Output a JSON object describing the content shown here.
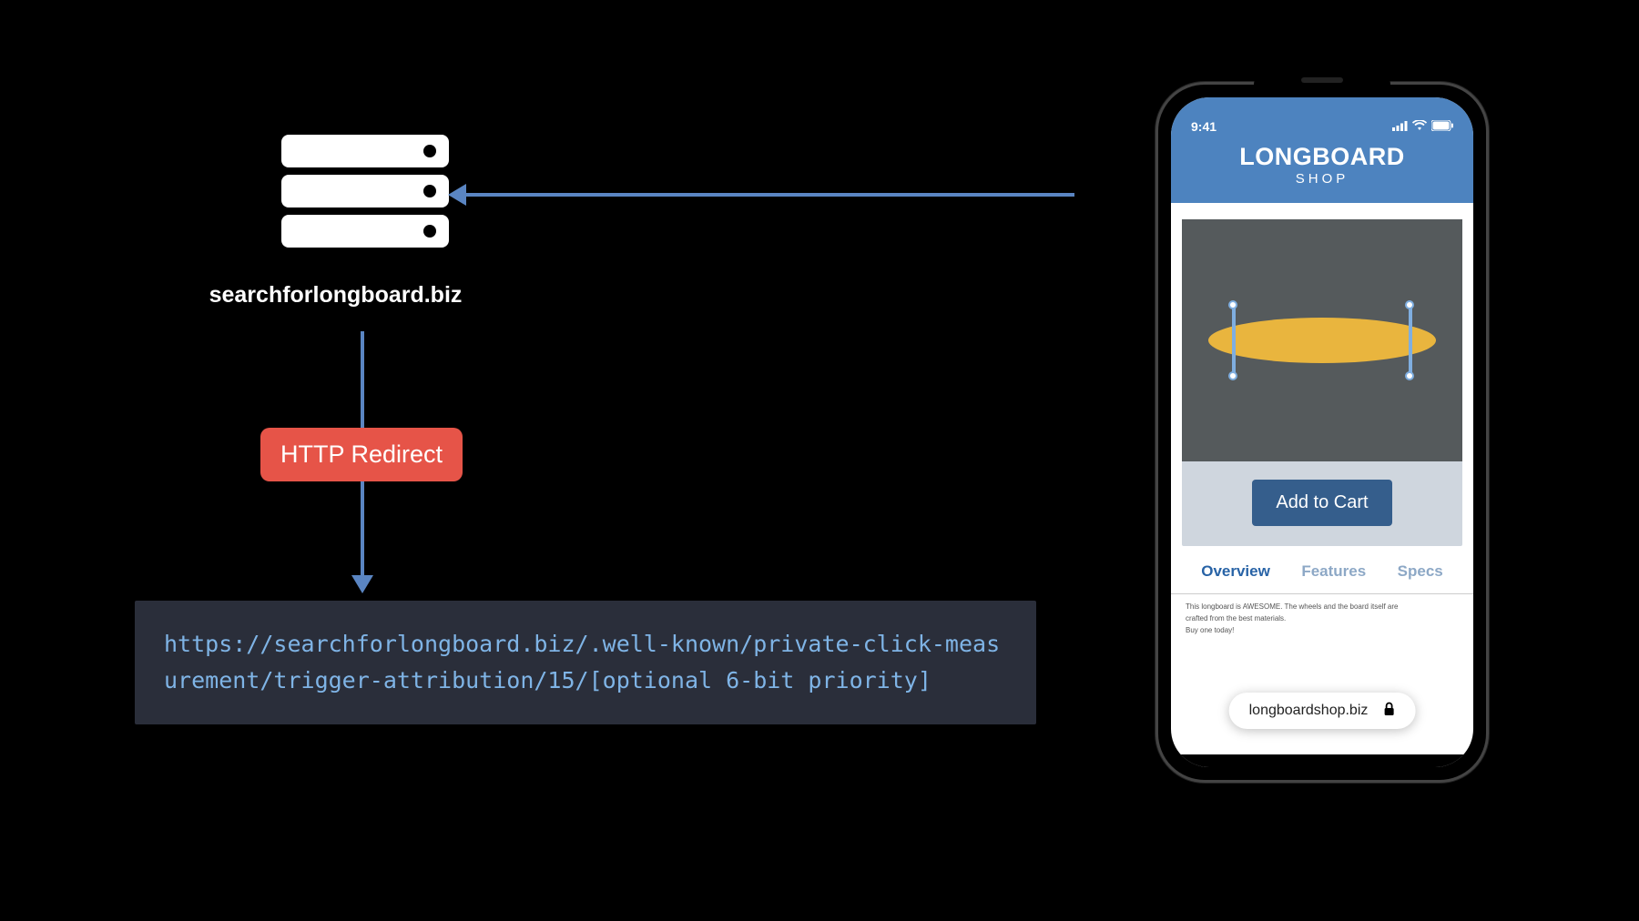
{
  "server": {
    "label": "searchforlongboard.biz"
  },
  "redirect": {
    "label": "HTTP Redirect"
  },
  "url": "https://searchforlongboard.biz/.well-known/private-click-measurement/trigger-attribution/15/[optional 6-bit priority]",
  "phone": {
    "status": {
      "time": "9:41"
    },
    "header": {
      "title": "LONGBOARD",
      "subtitle": "SHOP"
    },
    "cartButton": "Add to Cart",
    "tabs": {
      "overview": "Overview",
      "features": "Features",
      "specs": "Specs"
    },
    "description": {
      "line1": "This longboard is AWESOME. The wheels and the board itself are",
      "line2": "crafted from the best materials.",
      "line3": "Buy one today!"
    },
    "urlBar": "longboardshop.biz"
  }
}
